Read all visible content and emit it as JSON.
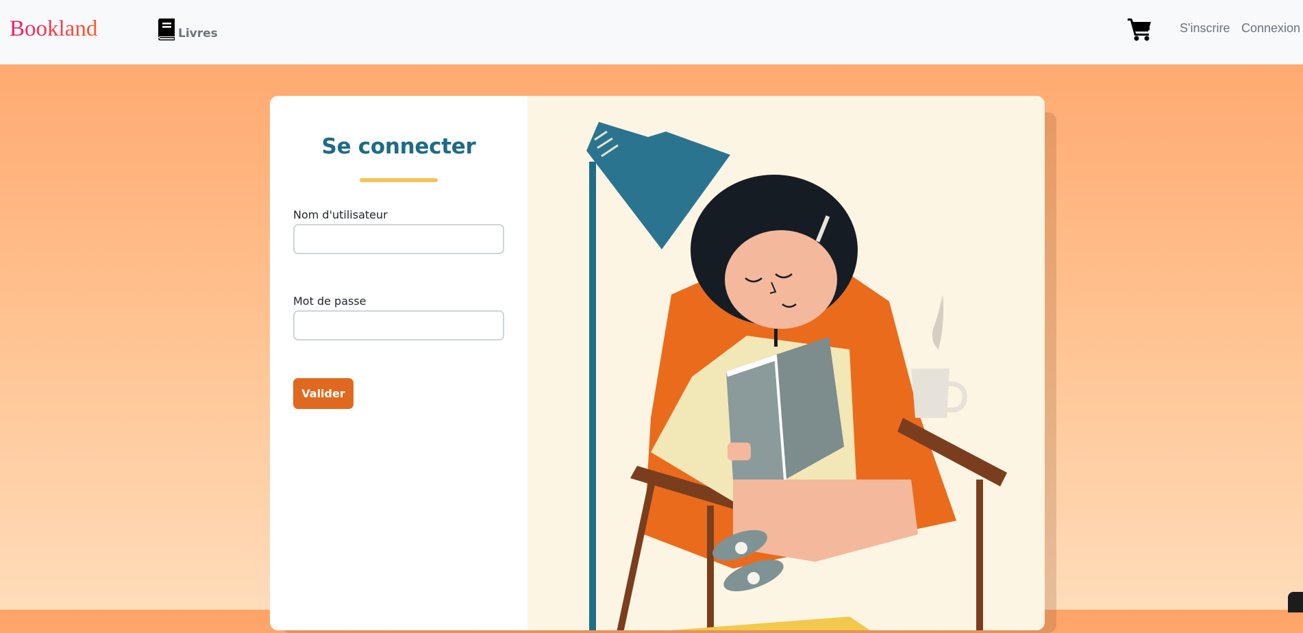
{
  "navbar": {
    "brand": "Bookland",
    "books_label": "Livres",
    "signup_label": "S'inscrire",
    "login_label": "Connexion",
    "icons": {
      "books": "book-icon",
      "cart": "shopping-cart-icon"
    }
  },
  "login_form": {
    "title": "Se connecter",
    "username_label": "Nom d'utilisateur",
    "username_value": "",
    "password_label": "Mot de passe",
    "password_value": "",
    "submit_label": "Valider"
  },
  "colors": {
    "brand_gradient": [
      "#f0186c",
      "#ff5a2a"
    ],
    "title": "#1d6b86",
    "underline": "#f3c45a",
    "button": "#e0691f",
    "page_gradient_top": "#ffa468",
    "page_gradient_bottom": "#ffdcbb"
  }
}
